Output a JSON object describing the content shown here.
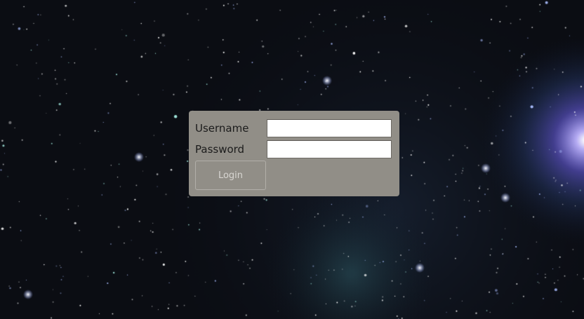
{
  "background": {
    "name": "starfield-nebula",
    "base_color": "#0b0d13",
    "nebula_color": "#7a6cff"
  },
  "login_form": {
    "panel_color": "#918e87",
    "username_label": "Username",
    "username_value": "",
    "password_label": "Password",
    "password_value": "",
    "login_button_label": "Login"
  }
}
